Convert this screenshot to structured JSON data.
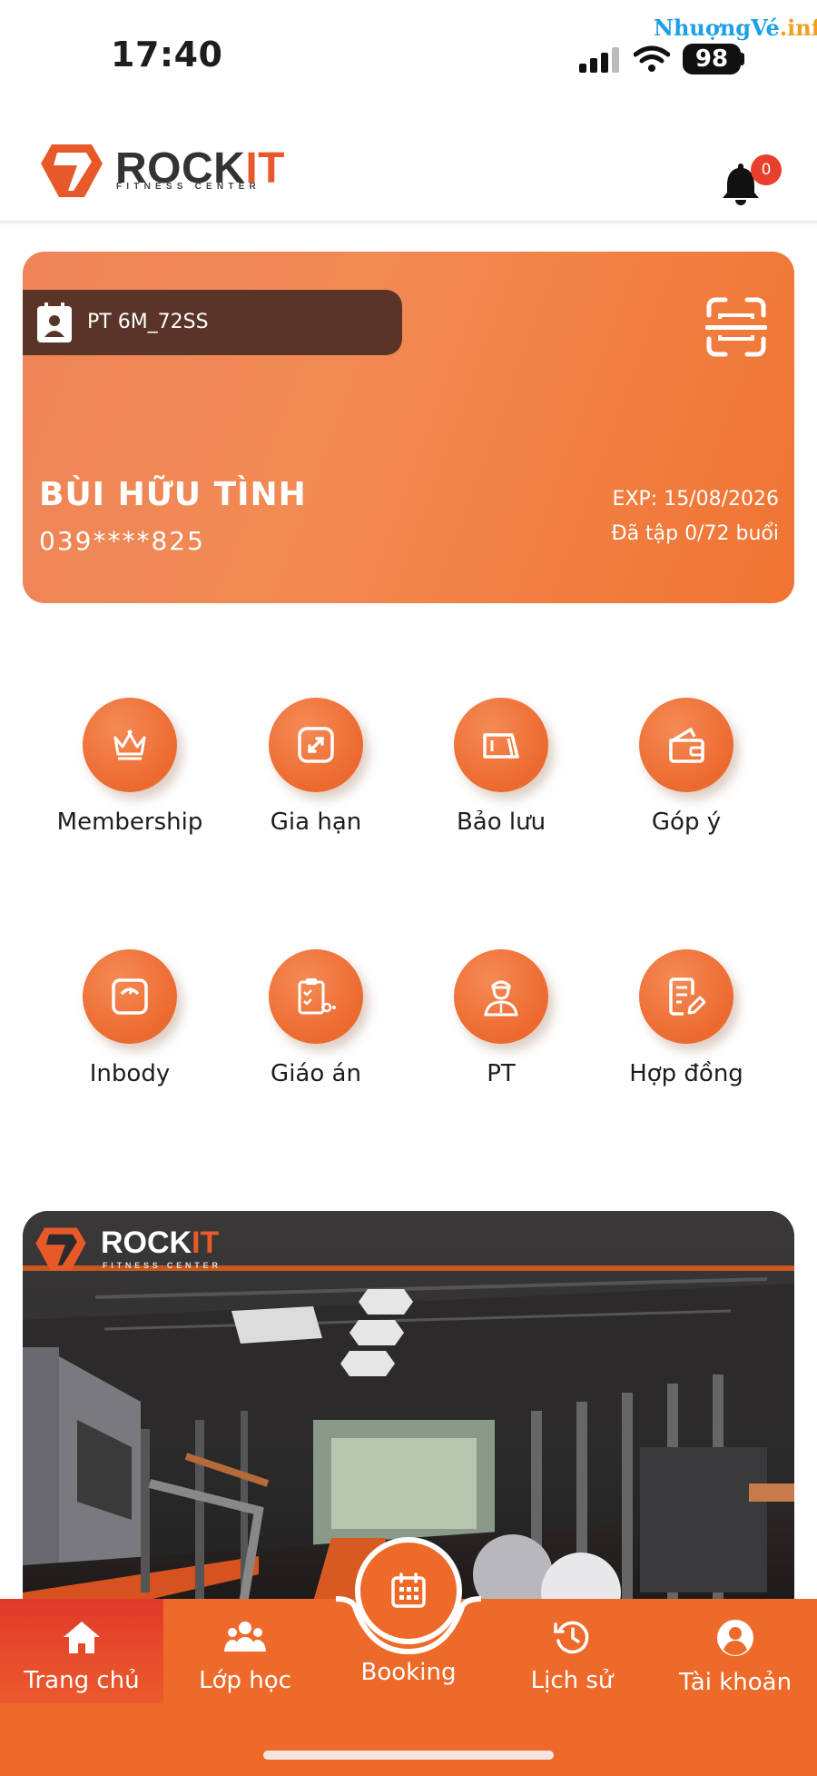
{
  "status_bar": {
    "time": "17:40",
    "battery": "98"
  },
  "watermark": {
    "part1": "NhuợngVé",
    "part2": ".info"
  },
  "header": {
    "logo_rock": "ROCK",
    "logo_it": "IT",
    "logo_sub": "FITNESS CENTER",
    "notification_count": "0"
  },
  "member_card": {
    "plan": "PT 6M_72SS",
    "name": "BÙI HỮU TÌNH",
    "phone": "039****825",
    "exp": "EXP: 15/08/2026",
    "sessions": "Đã tập 0/72 buổi"
  },
  "menu": [
    {
      "label": "Membership",
      "icon": "crown-icon"
    },
    {
      "label": "Gia hạn",
      "icon": "extend-icon"
    },
    {
      "label": "Bảo lưu",
      "icon": "card-pause-icon"
    },
    {
      "label": "Góp ý",
      "icon": "feedback-icon"
    },
    {
      "label": "Inbody",
      "icon": "scale-icon"
    },
    {
      "label": "Giáo án",
      "icon": "clipboard-plan-icon"
    },
    {
      "label": "PT",
      "icon": "trainer-icon"
    },
    {
      "label": "Hợp đồng",
      "icon": "contract-icon"
    }
  ],
  "banner": {
    "logo_rock": "ROCK",
    "logo_it": "IT",
    "logo_sub": "FITNESS CENTER"
  },
  "bottom_nav": [
    {
      "label": "Trang chủ",
      "icon": "home-icon",
      "active": true
    },
    {
      "label": "Lớp học",
      "icon": "group-icon"
    },
    {
      "label": "Booking",
      "icon": "calendar-icon"
    },
    {
      "label": "Lịch sử",
      "icon": "history-icon"
    },
    {
      "label": "Tài khoản",
      "icon": "account-icon"
    }
  ],
  "colors": {
    "brand": "#ee6a2a",
    "card_tag": "#5a3426",
    "badge": "#e8402d"
  }
}
